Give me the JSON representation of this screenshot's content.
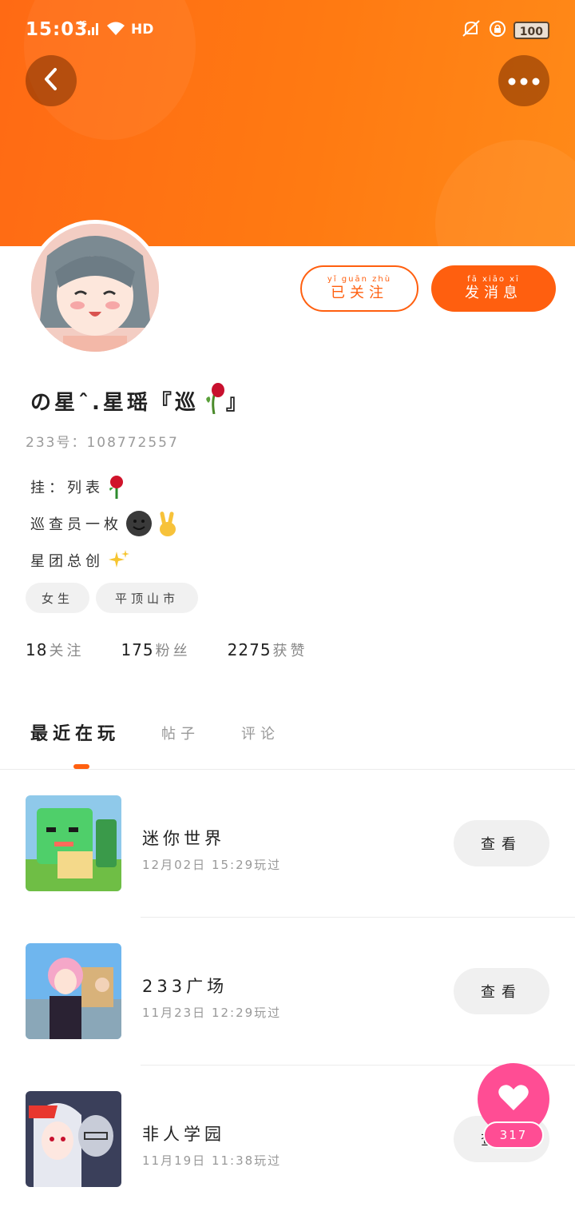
{
  "status_bar": {
    "time": "15:03",
    "network": "4G",
    "hd": "HD",
    "battery": "100"
  },
  "header": {
    "back_icon": "chevron-left-icon",
    "more_icon": "more-dots-icon"
  },
  "profile": {
    "follow_label": "已关注",
    "follow_pinyin": "yǐ guān zhù",
    "message_label": "发消息",
    "message_pinyin": "fā xiāo xī",
    "name": "の星ˆ.星瑶『巡",
    "name_suffix": "』",
    "uid": "233号：108772557",
    "bio": [
      "挂：列表",
      "巡查员一枚",
      "星团总创"
    ],
    "tags": [
      "女生",
      "平顶山市"
    ],
    "stats": [
      {
        "value": "18",
        "label": "关注"
      },
      {
        "value": "175",
        "label": "粉丝"
      },
      {
        "value": "2275",
        "label": "获赞"
      }
    ]
  },
  "tabs": [
    {
      "label": "最近在玩",
      "active": true
    },
    {
      "label": "帖子",
      "active": false
    },
    {
      "label": "评论",
      "active": false
    }
  ],
  "games": [
    {
      "title": "迷你世界",
      "time": "12月02日 15:29玩过",
      "button": "查看"
    },
    {
      "title": "233广场",
      "time": "11月23日 12:29玩过",
      "button": "查看"
    },
    {
      "title": "非人学园",
      "time": "11月19日 11:38玩过",
      "button": "查看"
    }
  ],
  "like": {
    "count": "317",
    "icon": "heart-icon"
  },
  "colors": {
    "accent": "#ff5f0f",
    "like": "#ff4d94"
  }
}
